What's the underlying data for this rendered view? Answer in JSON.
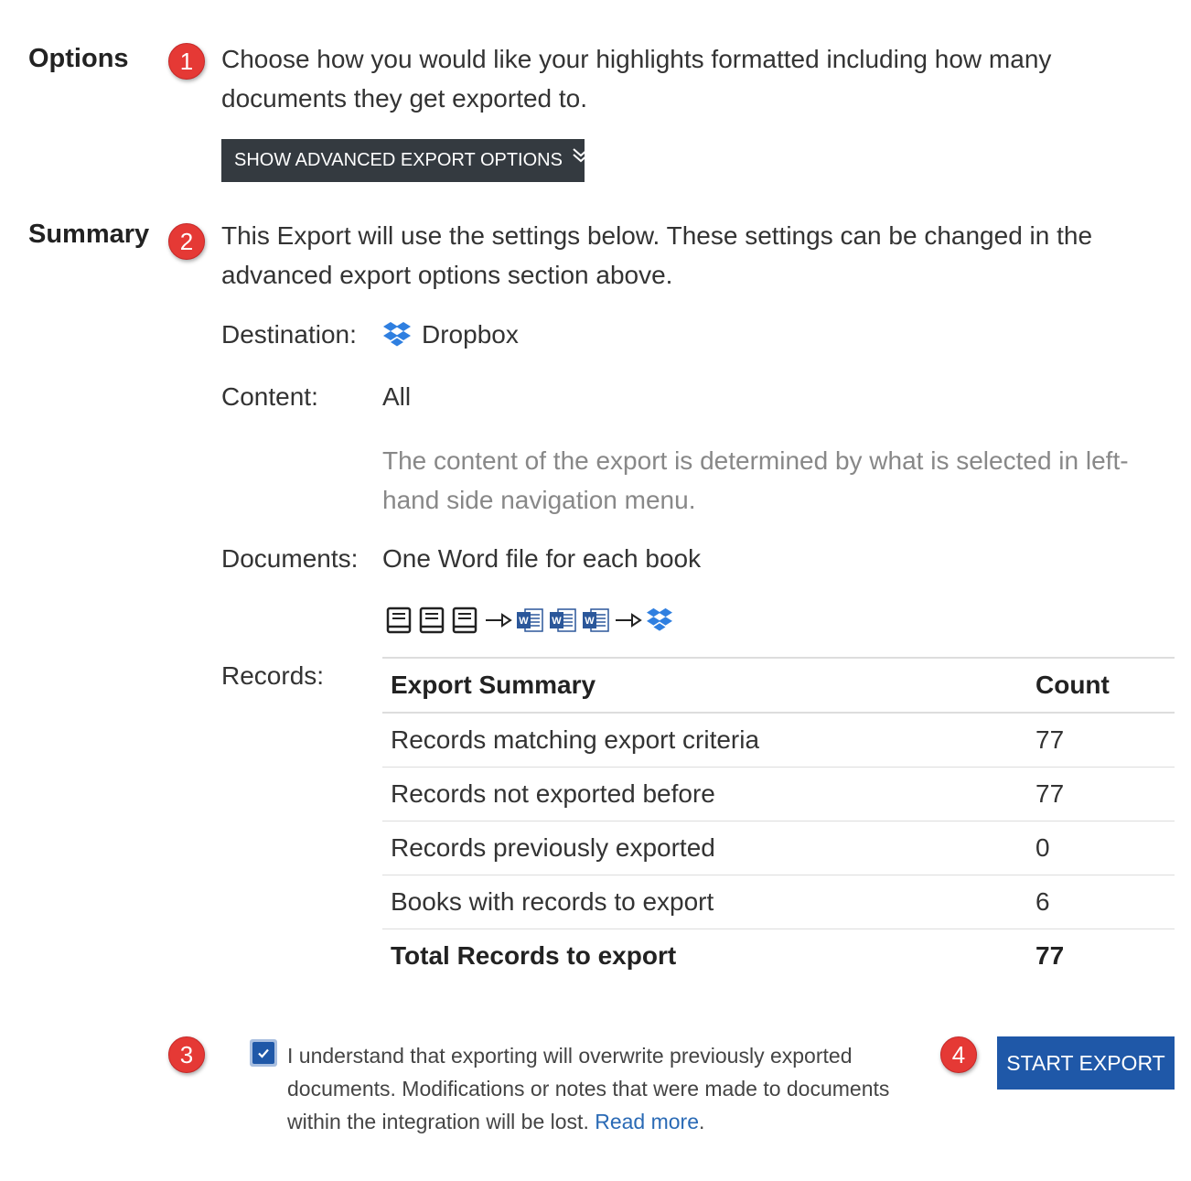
{
  "options": {
    "label": "Options",
    "badge": "1",
    "description": "Choose how you would like your highlights formatted including how many documents they get exported to.",
    "advanced_button_label": "SHOW ADVANCED EXPORT OPTIONS"
  },
  "summary": {
    "label": "Summary",
    "badge": "2",
    "description": "This Export will use the settings below. These settings can be changed in the advanced export options section above.",
    "destination_label": "Destination:",
    "destination_value": "Dropbox",
    "content_label": "Content:",
    "content_value": "All",
    "content_note": "The content of the export is determined by what is selected in left-hand side navigation menu.",
    "documents_label": "Documents:",
    "documents_value": "One Word file for each book",
    "records_label": "Records:"
  },
  "table": {
    "headers": [
      "Export Summary",
      "Count"
    ],
    "rows": [
      {
        "label": "Records matching export criteria",
        "count": "77"
      },
      {
        "label": "Records not exported before",
        "count": "77"
      },
      {
        "label": "Records previously exported",
        "count": "0"
      },
      {
        "label": "Books with records to export",
        "count": "6"
      }
    ],
    "total": {
      "label": "Total Records to export",
      "count": "77"
    }
  },
  "consent": {
    "badge": "3",
    "checked": true,
    "text": "I understand that exporting will overwrite previously exported documents. Modifications or notes that were made to documents within the integration will be lost.",
    "link_text": "Read more",
    "after_link": "."
  },
  "start": {
    "badge": "4",
    "button_label": "START EXPORT"
  },
  "colors": {
    "badge": "#e53935",
    "dark_button": "#343a40",
    "primary_button": "#1f58a8",
    "dropbox": "#2f7fe0",
    "word": "#2b579a",
    "link": "#2a6ab5",
    "muted_text": "#888888"
  },
  "icons": {
    "destination": "dropbox-icon",
    "flow": [
      "book-icon",
      "book-icon",
      "book-icon",
      "arrow-right-icon",
      "word-file-icon",
      "word-file-icon",
      "word-file-icon",
      "arrow-right-icon",
      "dropbox-icon"
    ],
    "advanced_button": "double-chevron-down-icon",
    "checkbox": "checkmark-icon"
  }
}
